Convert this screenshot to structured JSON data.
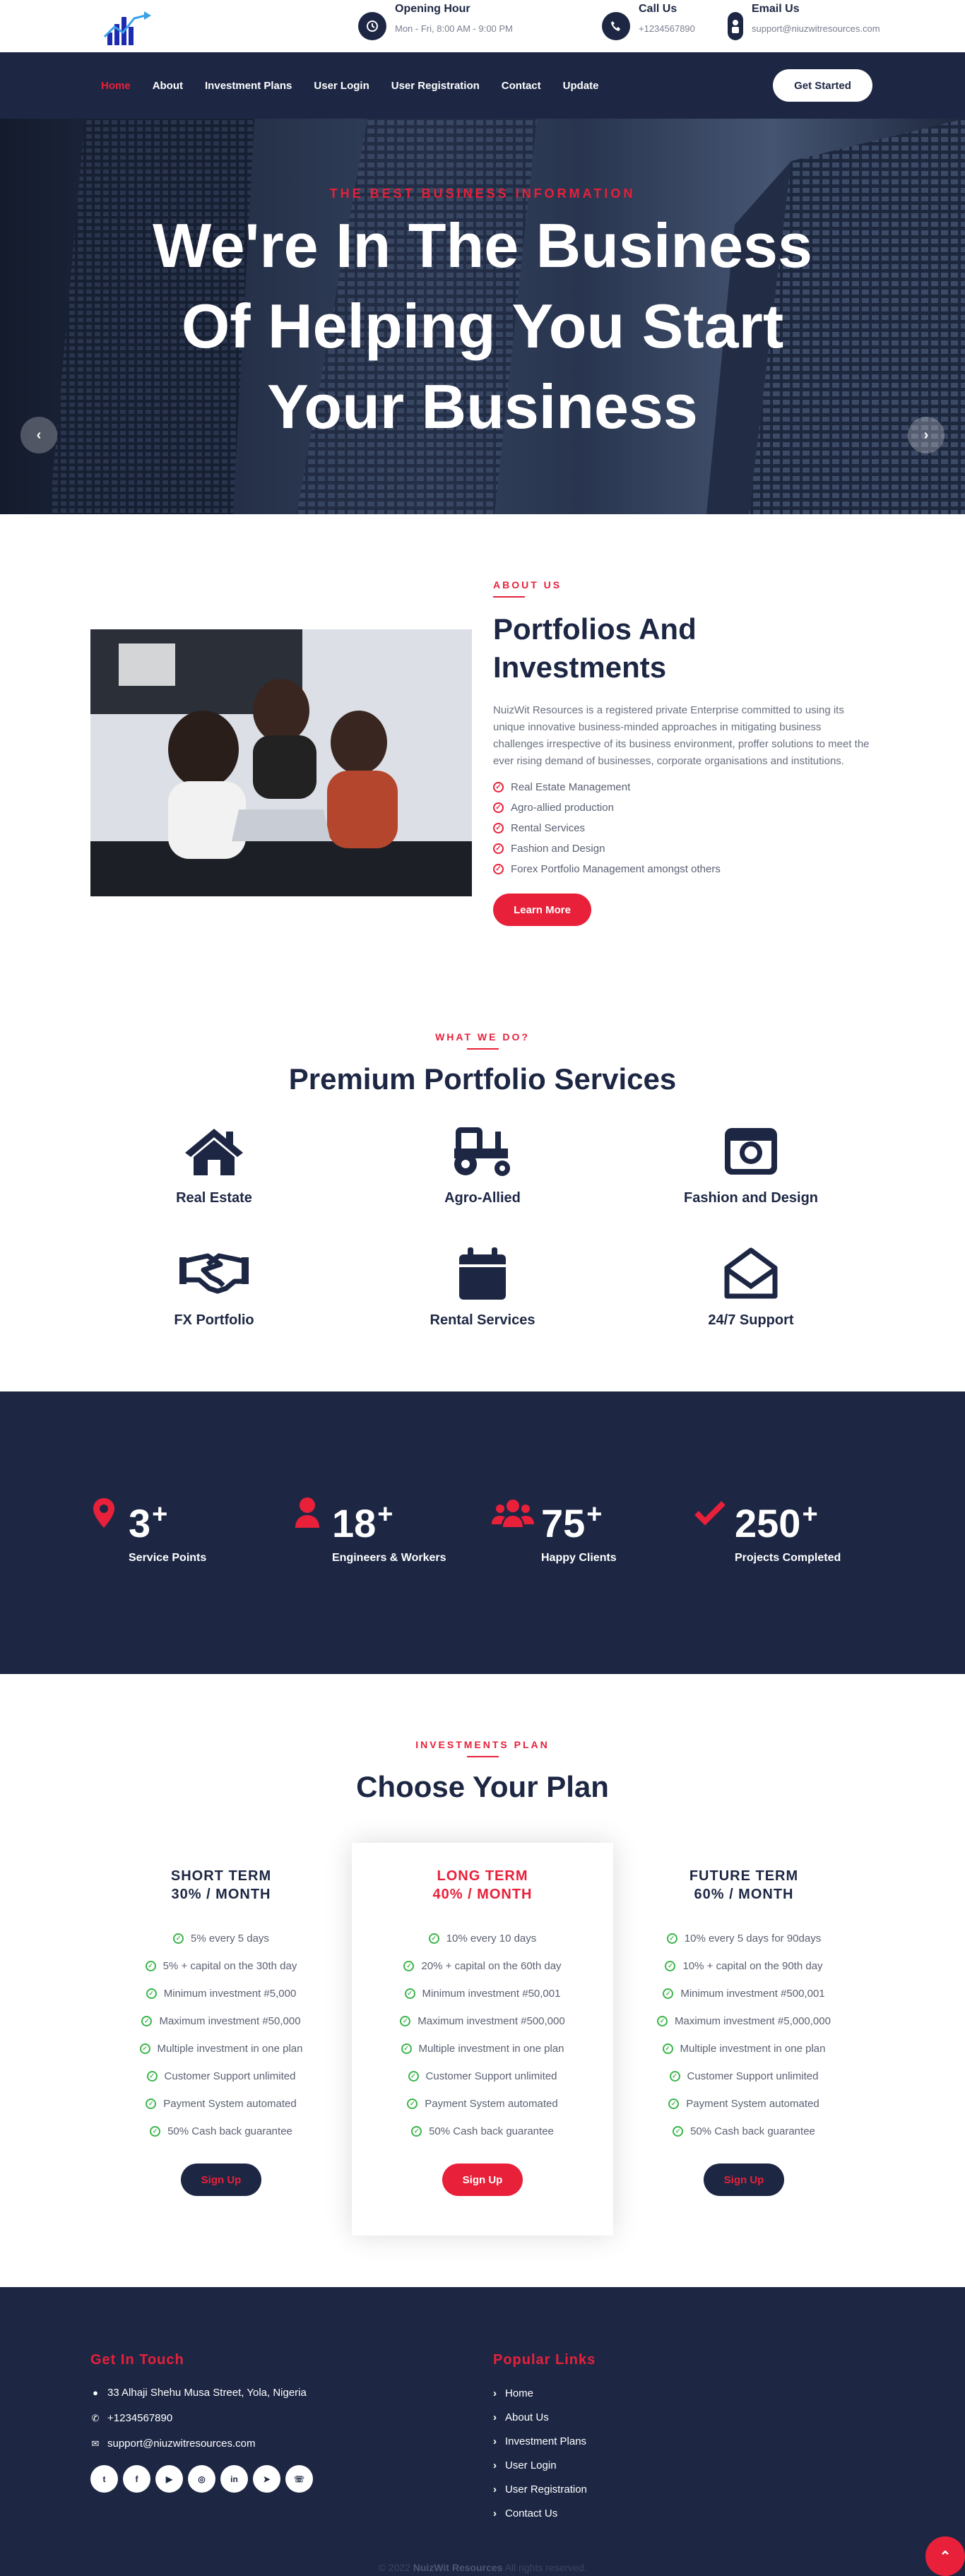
{
  "topbar": {
    "opening": {
      "title": "Opening Hour",
      "value": "Mon - Fri, 8:00 AM - 9:00 PM"
    },
    "call": {
      "title": "Call Us",
      "value": "+1234567890"
    },
    "email": {
      "title": "Email Us",
      "value": "support@niuzwitresources.com"
    }
  },
  "nav": {
    "items": [
      {
        "label": "Home"
      },
      {
        "label": "About"
      },
      {
        "label": "Investment Plans"
      },
      {
        "label": "User Login"
      },
      {
        "label": "User Registration"
      },
      {
        "label": "Contact"
      },
      {
        "label": "Update"
      }
    ],
    "cta": "Get Started"
  },
  "hero": {
    "kicker": "THE BEST BUSINESS INFORMATION",
    "title": "We're In The Business Of Helping You Start Your Business",
    "prev": "‹",
    "next": "›"
  },
  "about": {
    "kicker": "ABOUT US",
    "title": "Portfolios And Investments",
    "description": "NuizWit Resources is a registered private Enterprise committed to using its unique innovative business-minded approaches in mitigating business challenges irrespective of its business environment, proffer solutions to meet the ever rising demand of businesses, corporate organisations and institutions.",
    "items": [
      "Real Estate Management",
      "Agro-allied production",
      "Rental Services",
      "Fashion and Design",
      "Forex Portfolio Management amongst others"
    ],
    "button": "Learn More"
  },
  "services": {
    "kicker": "WHAT WE DO?",
    "title": "Premium Portfolio Services",
    "items": [
      {
        "label": "Real Estate",
        "icon": "house-icon"
      },
      {
        "label": "Agro-Allied",
        "icon": "tractor-icon"
      },
      {
        "label": "Fashion and Design",
        "icon": "camera-icon"
      },
      {
        "label": "FX Portfolio",
        "icon": "handshake-icon"
      },
      {
        "label": "Rental Services",
        "icon": "calendar-icon"
      },
      {
        "label": "24/7 Support",
        "icon": "envelope-open-icon"
      }
    ]
  },
  "facts": [
    {
      "number": "3",
      "suffix": "+",
      "label": "Service Points",
      "icon": "map-marker-icon"
    },
    {
      "number": "18",
      "suffix": "+",
      "label": "Engineers & Workers",
      "icon": "user-icon"
    },
    {
      "number": "75",
      "suffix": "+",
      "label": "Happy Clients",
      "icon": "users-icon"
    },
    {
      "number": "250",
      "suffix": "+",
      "label": "Projects Completed",
      "icon": "check-icon"
    }
  ],
  "pricing": {
    "kicker": "INVESTMENTS PLAN",
    "title": "Choose Your Plan",
    "plans": [
      {
        "name": "SHORT TERM",
        "rate": "30% / MONTH",
        "features": [
          "5% every 5 days",
          "5% + capital on the 30th day",
          "Minimum investment #5,000",
          "Maximum investment #50,000",
          "Multiple investment in one plan",
          "Customer Support unlimited",
          "Payment System automated",
          "50% Cash back guarantee"
        ],
        "button": "Sign Up"
      },
      {
        "name": "LONG TERM",
        "rate": "40% / MONTH",
        "features": [
          "10% every 10 days",
          "20% + capital on the 60th day",
          "Minimum investment #50,001",
          "Maximum investment #500,000",
          "Multiple investment in one plan",
          "Customer Support unlimited",
          "Payment System automated",
          "50% Cash back guarantee"
        ],
        "button": "Sign Up"
      },
      {
        "name": "FUTURE TERM",
        "rate": "60% / MONTH",
        "features": [
          "10% every 5 days for 90days",
          "10% + capital on the 90th day",
          "Minimum investment #500,001",
          "Maximum investment #5,000,000",
          "Multiple investment in one plan",
          "Customer Support unlimited",
          "Payment System automated",
          "50% Cash back guarantee"
        ],
        "button": "Sign Up"
      }
    ]
  },
  "footer": {
    "contact_title": "Get In Touch",
    "address": "33 Alhaji Shehu Musa Street, Yola, Nigeria",
    "phone": "+1234567890",
    "email": "support@niuzwitresources.com",
    "socials": [
      "twitter-icon",
      "facebook-icon",
      "youtube-icon",
      "instagram-icon",
      "linkedin-icon",
      "telegram-icon",
      "whatsapp-icon"
    ],
    "links_title": "Popular Links",
    "links": [
      "Home",
      "About Us",
      "Investment Plans",
      "User Login",
      "User Registration",
      "Contact Us"
    ],
    "copyright_prefix": "© 2022",
    "copyright_brand": "NuizWit Resources",
    "copyright_suffix": "All rights reserved."
  },
  "colors": {
    "navy": "#1d2744",
    "red": "#e8203a",
    "green": "#3bb54a"
  }
}
